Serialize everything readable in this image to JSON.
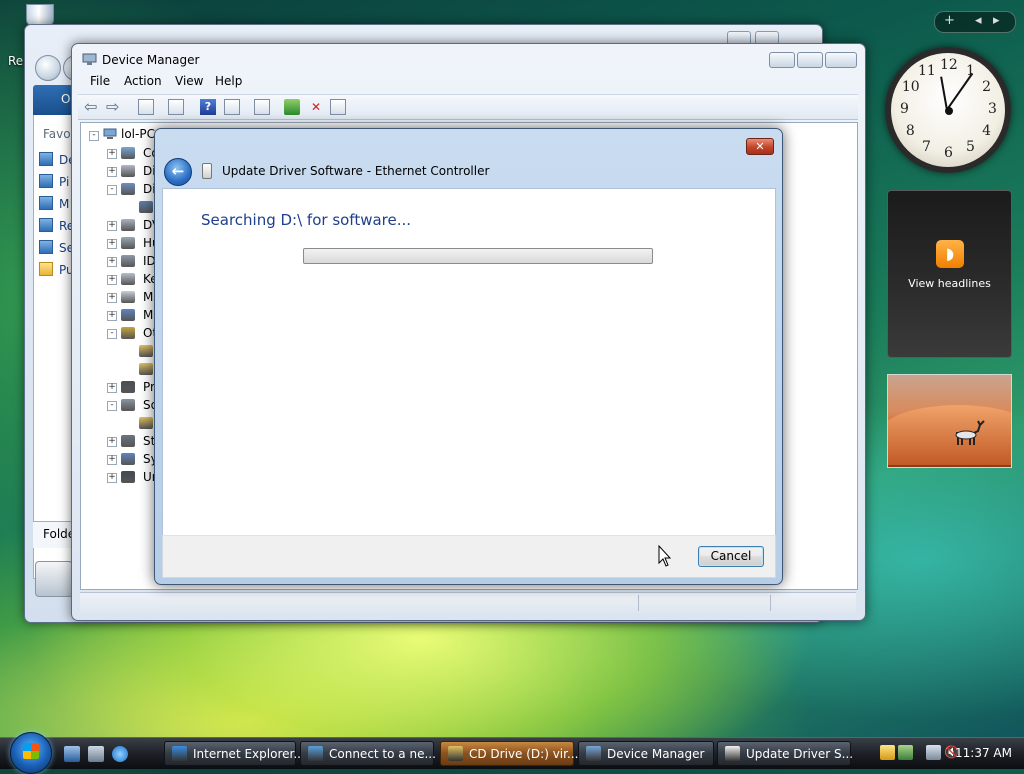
{
  "desktop": {
    "recycle_label": "Re"
  },
  "back_window": {
    "nav_header": "O",
    "favorites": "Favori",
    "nav_items": [
      "De",
      "Pi",
      "M",
      "Re",
      "Se",
      "Pu"
    ],
    "folders_label": "Folde"
  },
  "device_manager": {
    "title": "Device Manager",
    "menu": [
      "File",
      "Action",
      "View",
      "Help"
    ],
    "tree_root": "lol-PC",
    "tree_items": [
      {
        "label": "Co",
        "expander": "+"
      },
      {
        "label": "Di",
        "expander": "+"
      },
      {
        "label": "Di",
        "expander": "-"
      },
      {
        "label": "",
        "expander": ""
      },
      {
        "label": "DV",
        "expander": "+"
      },
      {
        "label": "Hu",
        "expander": "+"
      },
      {
        "label": "ID",
        "expander": "+"
      },
      {
        "label": "Ke",
        "expander": "+"
      },
      {
        "label": "M",
        "expander": "+"
      },
      {
        "label": "M",
        "expander": "+"
      },
      {
        "label": "Ot",
        "expander": "-"
      },
      {
        "label": "",
        "expander": ""
      },
      {
        "label": "",
        "expander": ""
      },
      {
        "label": "Pr",
        "expander": "+"
      },
      {
        "label": "So",
        "expander": "-"
      },
      {
        "label": "",
        "expander": ""
      },
      {
        "label": "St",
        "expander": "+"
      },
      {
        "label": "Sy",
        "expander": "+"
      },
      {
        "label": "Ur",
        "expander": "+"
      }
    ]
  },
  "dialog": {
    "title": "Update Driver Software - Ethernet Controller",
    "heading": "Searching D:\\ for software...",
    "progress": 0,
    "cancel_label": "Cancel",
    "close_glyph": "✕",
    "back_glyph": "←"
  },
  "sidebar": {
    "clock_numbers": [
      "12",
      "1",
      "2",
      "3",
      "4",
      "5",
      "6",
      "7",
      "8",
      "9",
      "10",
      "11"
    ],
    "feed_label": "View headlines",
    "feed_glyph": "◗",
    "controls": [
      "+",
      "◂",
      "▸"
    ]
  },
  "taskbar": {
    "buttons": [
      {
        "label": "Internet Explorer...",
        "icon": "ie-icon",
        "active": false
      },
      {
        "label": "Connect to a ne...",
        "icon": "network-icon",
        "active": false
      },
      {
        "label": "CD Drive (D:) vir...",
        "icon": "cd-drive-icon",
        "active": true
      },
      {
        "label": "Device Manager",
        "icon": "device-manager-icon",
        "active": false
      },
      {
        "label": "Update Driver S...",
        "icon": "update-driver-icon",
        "active": false
      }
    ],
    "time": "11:37 AM"
  }
}
